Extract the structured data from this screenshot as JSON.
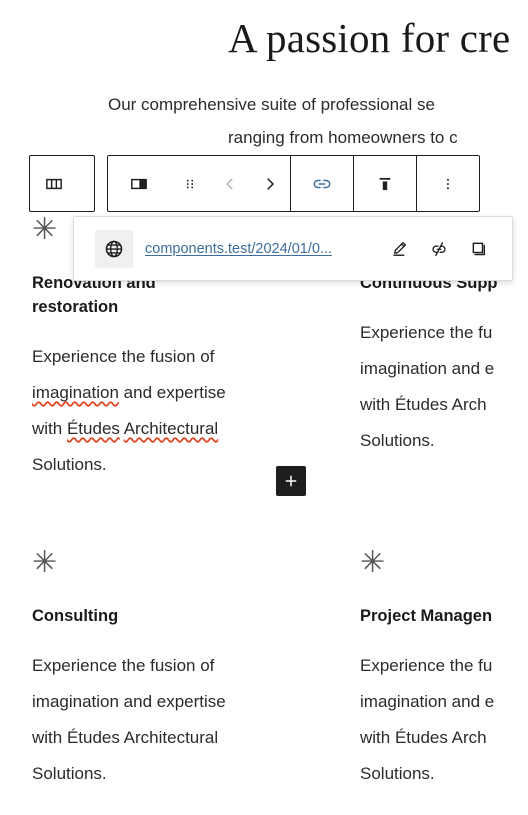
{
  "page": {
    "title": "A passion for cre",
    "subtitle_line1": "Our comprehensive suite of professional se",
    "subtitle_line2": "ranging from homeowners to c"
  },
  "services": {
    "row1": [
      {
        "icon": "asterisk-icon",
        "glyph": "✳",
        "title": "Renovation and\nrestoration",
        "body_prefix": "Experience the fusion of\n",
        "body_word1": "imagination",
        "body_mid": " and expertise\nwith ",
        "body_word2": "Études",
        "body_sp": " ",
        "body_word3": "Architectural",
        "body_suffix": "\nSolutions."
      },
      {
        "icon": "asterisk-icon",
        "glyph": "✳",
        "title": "Continuous Supp",
        "body": "Experience the fu\nimagination and e\nwith Études Arch\nSolutions."
      }
    ],
    "row2": [
      {
        "icon": "asterisk-icon",
        "glyph": "✳",
        "title": "Consulting",
        "body": "Experience the fusion of\nimagination and expertise\nwith Études Architectural\nSolutions."
      },
      {
        "icon": "asterisk-icon",
        "glyph": "✳",
        "title": "Project Managen",
        "body": "Experience the fu\nimagination and e\nwith Études Arch\nSolutions."
      }
    ]
  },
  "inserter": {
    "label": "+",
    "name": "add-block-button",
    "color": "#1e1e1e"
  },
  "toolbar": {
    "parent_block": "Select Columns",
    "block_type": "Column",
    "drag": "Drag",
    "move_up": "Move up",
    "move_down": "Move down",
    "link": "Link",
    "align": "Change vertical alignment",
    "options": "Options",
    "link_active_color": "#3c6e9f"
  },
  "link_popover": {
    "icon": "globe-icon",
    "url": "components.test/2024/01/0...",
    "url_color": "#3c6e9f",
    "edit": "Edit",
    "unlink": "Unlink",
    "copy": "Copy link"
  }
}
